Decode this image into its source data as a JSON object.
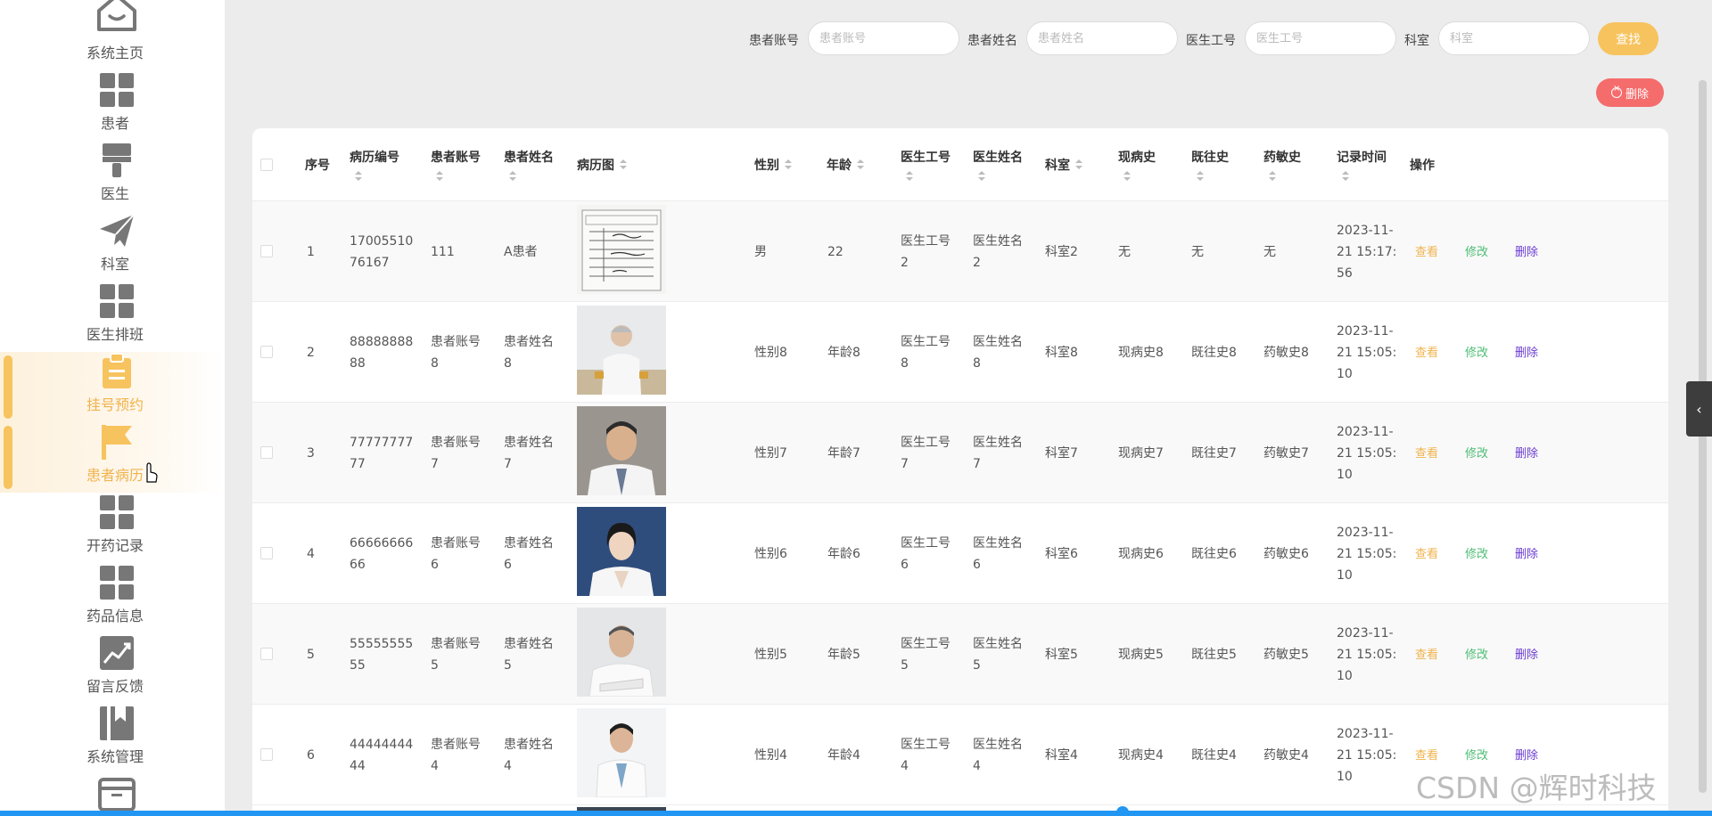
{
  "sidebar": {
    "items": [
      {
        "label": "系统主页",
        "icon": "home-icon"
      },
      {
        "label": "患者",
        "icon": "grid-icon"
      },
      {
        "label": "医生",
        "icon": "brush-icon"
      },
      {
        "label": "科室",
        "icon": "paper-plane-icon"
      },
      {
        "label": "医生排班",
        "icon": "grid-icon"
      },
      {
        "label": "挂号预约",
        "icon": "clipboard-icon",
        "active": true
      },
      {
        "label": "患者病历",
        "icon": "flag-icon",
        "active": true
      },
      {
        "label": "开药记录",
        "icon": "grid-icon"
      },
      {
        "label": "药品信息",
        "icon": "grid-icon"
      },
      {
        "label": "留言反馈",
        "icon": "chart-icon"
      },
      {
        "label": "系统管理",
        "icon": "bookmark-icon"
      },
      {
        "label": "",
        "icon": "archive-icon"
      }
    ],
    "accent": "#f0b34d"
  },
  "search": {
    "patient_account_label": "患者账号",
    "patient_account_placeholder": "患者账号",
    "patient_name_label": "患者姓名",
    "patient_name_placeholder": "患者姓名",
    "doctor_id_label": "医生工号",
    "doctor_id_placeholder": "医生工号",
    "department_label": "科室",
    "department_placeholder": "科室",
    "search_button": "查找"
  },
  "toolbar": {
    "delete_button": "删除"
  },
  "table": {
    "headers": {
      "index": "序号",
      "record_no": "病历编号",
      "patient_account": "患者账号",
      "patient_name": "患者姓名",
      "record_image": "病历图",
      "gender": "性别",
      "age": "年龄",
      "doctor_id": "医生工号",
      "doctor_name": "医生姓名",
      "department": "科室",
      "present_history": "现病史",
      "past_history": "既往史",
      "allergy_history": "药敏史",
      "record_time": "记录时间",
      "actions": "操作"
    },
    "actions": {
      "view": "查看",
      "edit": "修改",
      "delete": "删除"
    },
    "rows": [
      {
        "index": "1",
        "record_no_a": "17005510",
        "record_no_b": "76167",
        "patient_account_a": "111",
        "patient_account_b": "",
        "patient_name_a": "A患者",
        "patient_name_b": "",
        "gender": "男",
        "age": "22",
        "doctor_id_a": "医生工号",
        "doctor_id_b": "2",
        "doctor_name_a": "医生姓名",
        "doctor_name_b": "2",
        "department": "科室2",
        "present": "无",
        "past": "无",
        "allergy": "无",
        "time_a": "2023-11-",
        "time_b": "21 15:17:",
        "time_c": "56",
        "image": "paper-record"
      },
      {
        "index": "2",
        "record_no_a": "88888888",
        "record_no_b": "88",
        "patient_account_a": "患者账号",
        "patient_account_b": "8",
        "patient_name_a": "患者姓名",
        "patient_name_b": "8",
        "gender": "性别8",
        "age": "年龄8",
        "doctor_id_a": "医生工号",
        "doctor_id_b": "8",
        "doctor_name_a": "医生姓名",
        "doctor_name_b": "8",
        "department": "科室8",
        "present": "现病史8",
        "past": "既往史8",
        "allergy": "药敏史8",
        "time_a": "2023-11-",
        "time_b": "21 15:05:",
        "time_c": "10",
        "image": "doctor-photo"
      },
      {
        "index": "3",
        "record_no_a": "77777777",
        "record_no_b": "77",
        "patient_account_a": "患者账号",
        "patient_account_b": "7",
        "patient_name_a": "患者姓名",
        "patient_name_b": "7",
        "gender": "性别7",
        "age": "年龄7",
        "doctor_id_a": "医生工号",
        "doctor_id_b": "7",
        "doctor_name_a": "医生姓名",
        "doctor_name_b": "7",
        "department": "科室7",
        "present": "现病史7",
        "past": "既往史7",
        "allergy": "药敏史7",
        "time_a": "2023-11-",
        "time_b": "21 15:05:",
        "time_c": "10",
        "image": "doctor-photo"
      },
      {
        "index": "4",
        "record_no_a": "66666666",
        "record_no_b": "66",
        "patient_account_a": "患者账号",
        "patient_account_b": "6",
        "patient_name_a": "患者姓名",
        "patient_name_b": "6",
        "gender": "性别6",
        "age": "年龄6",
        "doctor_id_a": "医生工号",
        "doctor_id_b": "6",
        "doctor_name_a": "医生姓名",
        "doctor_name_b": "6",
        "department": "科室6",
        "present": "现病史6",
        "past": "既往史6",
        "allergy": "药敏史6",
        "time_a": "2023-11-",
        "time_b": "21 15:05:",
        "time_c": "10",
        "image": "doctor-photo"
      },
      {
        "index": "5",
        "record_no_a": "55555555",
        "record_no_b": "55",
        "patient_account_a": "患者账号",
        "patient_account_b": "5",
        "patient_name_a": "患者姓名",
        "patient_name_b": "5",
        "gender": "性别5",
        "age": "年龄5",
        "doctor_id_a": "医生工号",
        "doctor_id_b": "5",
        "doctor_name_a": "医生姓名",
        "doctor_name_b": "5",
        "department": "科室5",
        "present": "现病史5",
        "past": "既往史5",
        "allergy": "药敏史5",
        "time_a": "2023-11-",
        "time_b": "21 15:05:",
        "time_c": "10",
        "image": "doctor-photo"
      },
      {
        "index": "6",
        "record_no_a": "44444444",
        "record_no_b": "44",
        "patient_account_a": "患者账号",
        "patient_account_b": "4",
        "patient_name_a": "患者姓名",
        "patient_name_b": "4",
        "gender": "性别4",
        "age": "年龄4",
        "doctor_id_a": "医生工号",
        "doctor_id_b": "4",
        "doctor_name_a": "医生姓名",
        "doctor_name_b": "4",
        "department": "科室4",
        "present": "现病史4",
        "past": "既往史4",
        "allergy": "药敏史4",
        "time_a": "2023-11-",
        "time_b": "21 15:05:",
        "time_c": "10",
        "image": "doctor-photo"
      }
    ]
  },
  "watermark": "CSDN @辉时科技"
}
